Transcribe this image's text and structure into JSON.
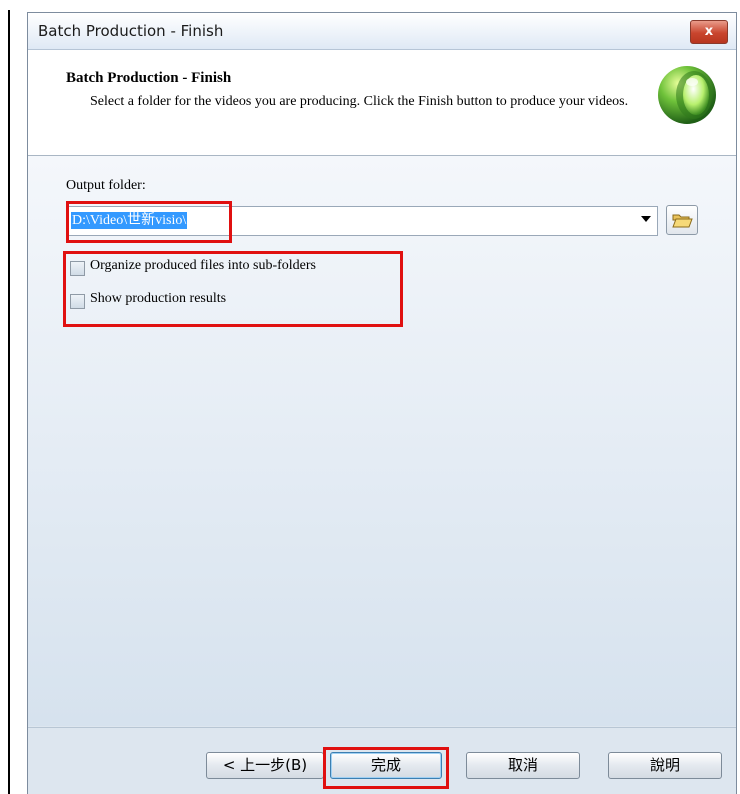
{
  "window": {
    "title": "Batch Production - Finish",
    "close_label": "x"
  },
  "header": {
    "title": "Batch Production - Finish",
    "description": "Select a folder for the videos you are producing.  Click the Finish button to produce your videos."
  },
  "form": {
    "output_folder_label": "Output folder:",
    "output_folder_value": "D:\\Video\\世新visio\\",
    "checkbox_subfolders_label": "Organize produced files into sub-folders",
    "checkbox_subfolders_checked": false,
    "checkbox_results_label": "Show production results",
    "checkbox_results_checked": false
  },
  "buttons": {
    "back": "< 上一步(B)",
    "finish": "完成",
    "cancel": "取消",
    "help": "說明"
  },
  "icons": {
    "logo": "green-sphere-logo-icon",
    "browse": "folder-open-icon",
    "dropdown": "chevron-down-icon"
  },
  "colors": {
    "highlight": "#3399ff",
    "annotation": "#e01010"
  }
}
